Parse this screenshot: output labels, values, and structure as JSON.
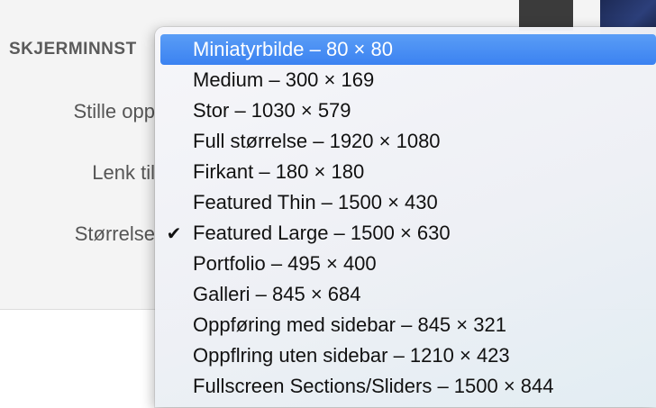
{
  "panel": {
    "section_title": "SKJERMINNST",
    "labels": {
      "alignment": "Stille opp",
      "link_to": "Lenk til",
      "size": "Størrelse"
    }
  },
  "size_menu": {
    "selected_index": 6,
    "highlighted_index": 0,
    "check_glyph": "✔",
    "items": [
      "Miniatyrbilde – 80 × 80",
      "Medium – 300 × 169",
      "Stor – 1030 × 579",
      "Full størrelse – 1920 × 1080",
      "Firkant – 180 × 180",
      "Featured Thin – 1500 × 430",
      "Featured Large – 1500 × 630",
      "Portfolio – 495 × 400",
      "Galleri – 845 × 684",
      "Oppføring med sidebar – 845 × 321",
      "Oppflring uten sidebar – 1210 × 423",
      "Fullscreen Sections/Sliders – 1500 × 844"
    ]
  },
  "colors": {
    "highlight": "#3b82f1",
    "panel_background": "#f4f4f4"
  }
}
